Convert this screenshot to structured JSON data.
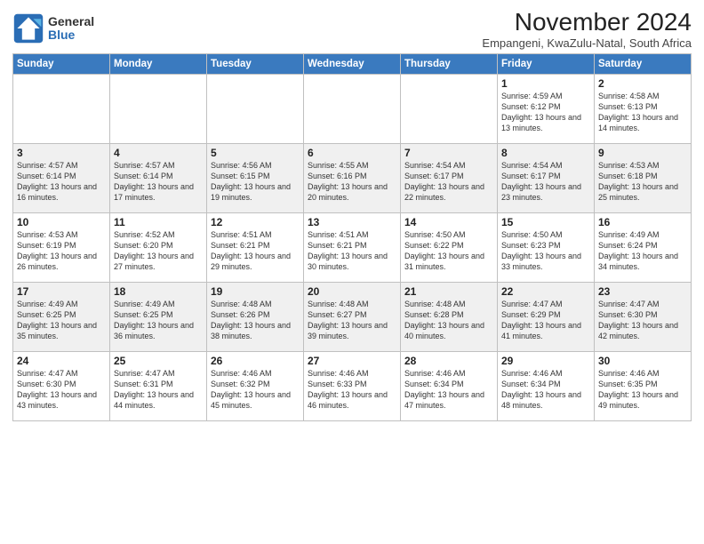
{
  "logo": {
    "general": "General",
    "blue": "Blue"
  },
  "title": "November 2024",
  "subtitle": "Empangeni, KwaZulu-Natal, South Africa",
  "headers": [
    "Sunday",
    "Monday",
    "Tuesday",
    "Wednesday",
    "Thursday",
    "Friday",
    "Saturday"
  ],
  "weeks": [
    [
      {
        "day": "",
        "info": ""
      },
      {
        "day": "",
        "info": ""
      },
      {
        "day": "",
        "info": ""
      },
      {
        "day": "",
        "info": ""
      },
      {
        "day": "",
        "info": ""
      },
      {
        "day": "1",
        "info": "Sunrise: 4:59 AM\nSunset: 6:12 PM\nDaylight: 13 hours\nand 13 minutes."
      },
      {
        "day": "2",
        "info": "Sunrise: 4:58 AM\nSunset: 6:13 PM\nDaylight: 13 hours\nand 14 minutes."
      }
    ],
    [
      {
        "day": "3",
        "info": "Sunrise: 4:57 AM\nSunset: 6:14 PM\nDaylight: 13 hours\nand 16 minutes."
      },
      {
        "day": "4",
        "info": "Sunrise: 4:57 AM\nSunset: 6:14 PM\nDaylight: 13 hours\nand 17 minutes."
      },
      {
        "day": "5",
        "info": "Sunrise: 4:56 AM\nSunset: 6:15 PM\nDaylight: 13 hours\nand 19 minutes."
      },
      {
        "day": "6",
        "info": "Sunrise: 4:55 AM\nSunset: 6:16 PM\nDaylight: 13 hours\nand 20 minutes."
      },
      {
        "day": "7",
        "info": "Sunrise: 4:54 AM\nSunset: 6:17 PM\nDaylight: 13 hours\nand 22 minutes."
      },
      {
        "day": "8",
        "info": "Sunrise: 4:54 AM\nSunset: 6:17 PM\nDaylight: 13 hours\nand 23 minutes."
      },
      {
        "day": "9",
        "info": "Sunrise: 4:53 AM\nSunset: 6:18 PM\nDaylight: 13 hours\nand 25 minutes."
      }
    ],
    [
      {
        "day": "10",
        "info": "Sunrise: 4:53 AM\nSunset: 6:19 PM\nDaylight: 13 hours\nand 26 minutes."
      },
      {
        "day": "11",
        "info": "Sunrise: 4:52 AM\nSunset: 6:20 PM\nDaylight: 13 hours\nand 27 minutes."
      },
      {
        "day": "12",
        "info": "Sunrise: 4:51 AM\nSunset: 6:21 PM\nDaylight: 13 hours\nand 29 minutes."
      },
      {
        "day": "13",
        "info": "Sunrise: 4:51 AM\nSunset: 6:21 PM\nDaylight: 13 hours\nand 30 minutes."
      },
      {
        "day": "14",
        "info": "Sunrise: 4:50 AM\nSunset: 6:22 PM\nDaylight: 13 hours\nand 31 minutes."
      },
      {
        "day": "15",
        "info": "Sunrise: 4:50 AM\nSunset: 6:23 PM\nDaylight: 13 hours\nand 33 minutes."
      },
      {
        "day": "16",
        "info": "Sunrise: 4:49 AM\nSunset: 6:24 PM\nDaylight: 13 hours\nand 34 minutes."
      }
    ],
    [
      {
        "day": "17",
        "info": "Sunrise: 4:49 AM\nSunset: 6:25 PM\nDaylight: 13 hours\nand 35 minutes."
      },
      {
        "day": "18",
        "info": "Sunrise: 4:49 AM\nSunset: 6:25 PM\nDaylight: 13 hours\nand 36 minutes."
      },
      {
        "day": "19",
        "info": "Sunrise: 4:48 AM\nSunset: 6:26 PM\nDaylight: 13 hours\nand 38 minutes."
      },
      {
        "day": "20",
        "info": "Sunrise: 4:48 AM\nSunset: 6:27 PM\nDaylight: 13 hours\nand 39 minutes."
      },
      {
        "day": "21",
        "info": "Sunrise: 4:48 AM\nSunset: 6:28 PM\nDaylight: 13 hours\nand 40 minutes."
      },
      {
        "day": "22",
        "info": "Sunrise: 4:47 AM\nSunset: 6:29 PM\nDaylight: 13 hours\nand 41 minutes."
      },
      {
        "day": "23",
        "info": "Sunrise: 4:47 AM\nSunset: 6:30 PM\nDaylight: 13 hours\nand 42 minutes."
      }
    ],
    [
      {
        "day": "24",
        "info": "Sunrise: 4:47 AM\nSunset: 6:30 PM\nDaylight: 13 hours\nand 43 minutes."
      },
      {
        "day": "25",
        "info": "Sunrise: 4:47 AM\nSunset: 6:31 PM\nDaylight: 13 hours\nand 44 minutes."
      },
      {
        "day": "26",
        "info": "Sunrise: 4:46 AM\nSunset: 6:32 PM\nDaylight: 13 hours\nand 45 minutes."
      },
      {
        "day": "27",
        "info": "Sunrise: 4:46 AM\nSunset: 6:33 PM\nDaylight: 13 hours\nand 46 minutes."
      },
      {
        "day": "28",
        "info": "Sunrise: 4:46 AM\nSunset: 6:34 PM\nDaylight: 13 hours\nand 47 minutes."
      },
      {
        "day": "29",
        "info": "Sunrise: 4:46 AM\nSunset: 6:34 PM\nDaylight: 13 hours\nand 48 minutes."
      },
      {
        "day": "30",
        "info": "Sunrise: 4:46 AM\nSunset: 6:35 PM\nDaylight: 13 hours\nand 49 minutes."
      }
    ]
  ]
}
